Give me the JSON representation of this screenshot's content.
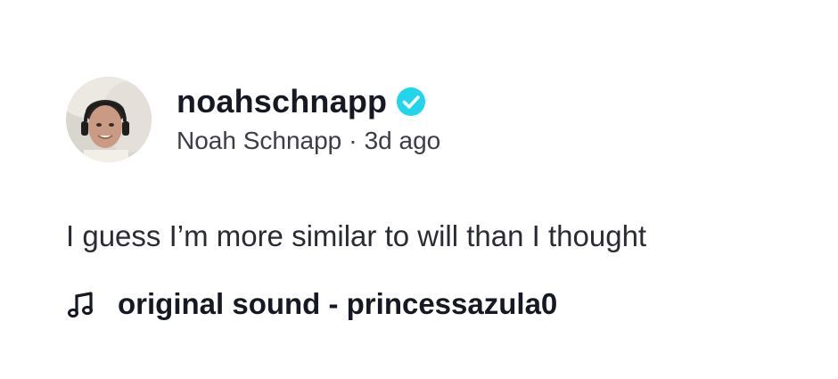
{
  "post": {
    "author": {
      "username": "noahschnapp",
      "display_name": "Noah Schnapp",
      "separator": "·",
      "posted_ago": "3d ago",
      "verified": true,
      "verified_icon": "verified-check-icon",
      "verified_color": "#20d5ec"
    },
    "caption": "I guess I’m more similar to will than I thought",
    "music": {
      "icon": "music-note-icon",
      "title": "original sound - princessazula0"
    }
  }
}
